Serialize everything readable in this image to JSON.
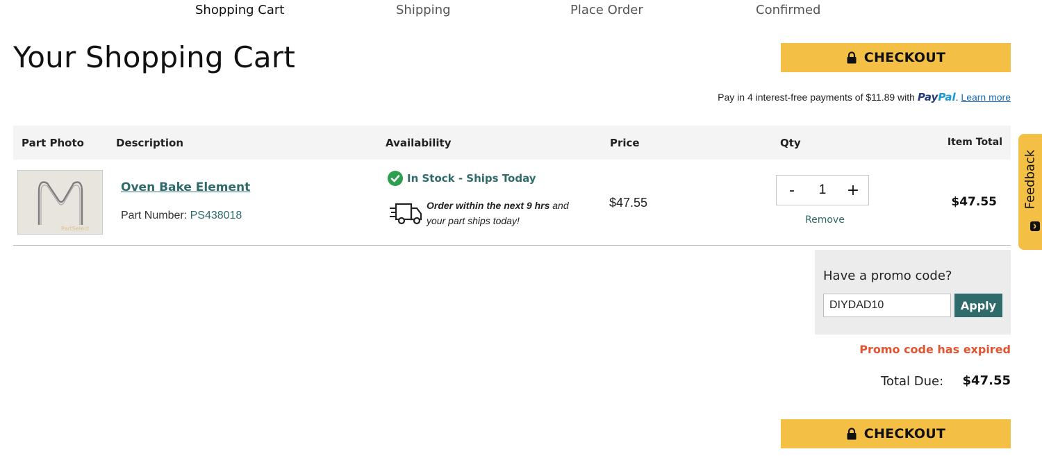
{
  "steps": [
    "Shopping Cart",
    "Shipping",
    "Place Order",
    "Confirmed"
  ],
  "page_title": "Your Shopping Cart",
  "checkout_label": "CHECKOUT",
  "paypal": {
    "text": "Pay in 4 interest-free payments of $11.89 with",
    "logo_part1": "Pay",
    "logo_part2": "Pal",
    "suffix": ".",
    "learn_more": "Learn more"
  },
  "table": {
    "headers": [
      "Part Photo",
      "Description",
      "Availability",
      "Price",
      "Qty",
      "Item Total"
    ]
  },
  "item": {
    "name": "Oven Bake Element",
    "part_number_label": "Part Number:",
    "part_number": "PS438018",
    "photo_watermark": "PartSelect",
    "availability": "In Stock - Ships Today",
    "ship_msg_bold": "Order within the next 9 hrs",
    "ship_msg_rest1": " and",
    "ship_msg_line2": "your part ships today!",
    "price": "$47.55",
    "qty_minus": "-",
    "qty": "1",
    "qty_plus": "+",
    "remove": "Remove",
    "item_total": "$47.55"
  },
  "promo": {
    "label": "Have a promo code?",
    "value": "DIYDAD10",
    "apply": "Apply",
    "error": "Promo code has expired"
  },
  "total": {
    "label": "Total Due:",
    "value": "$47.55"
  },
  "feedback_label": "Feedback",
  "colors": {
    "accent": "#f3bf44",
    "teal": "#2f6b6b",
    "error": "#e2542f",
    "success": "#2e9e4f"
  }
}
